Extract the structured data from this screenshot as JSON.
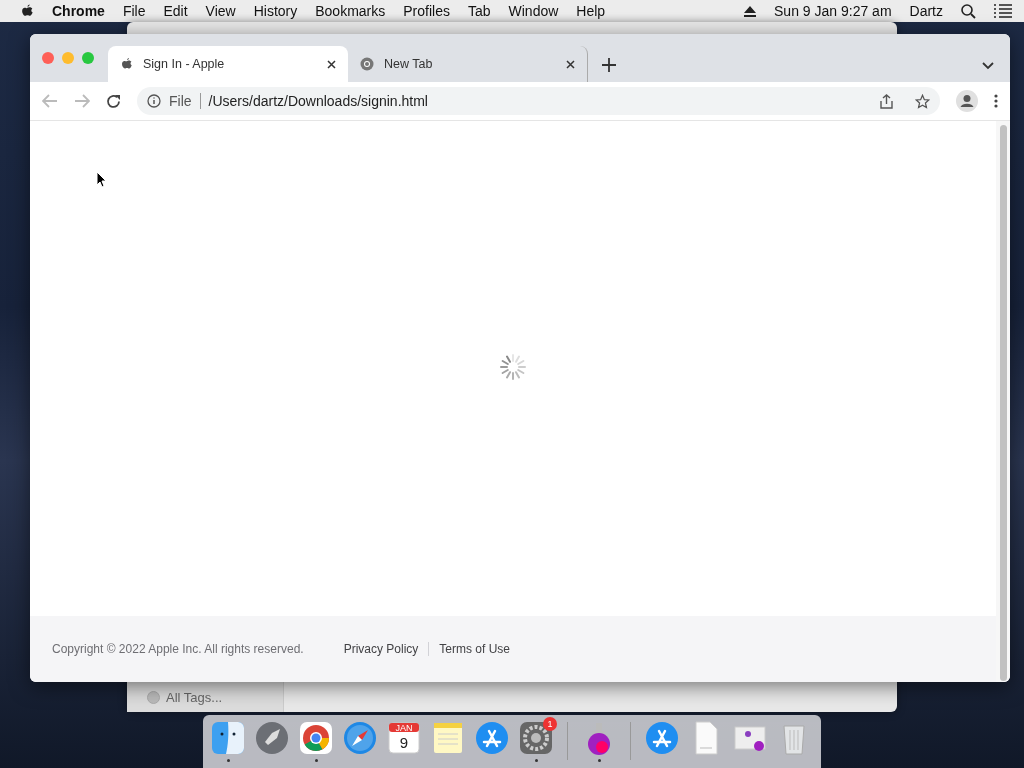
{
  "menubar": {
    "app": "Chrome",
    "menus": [
      "File",
      "Edit",
      "View",
      "History",
      "Bookmarks",
      "Profiles",
      "Tab",
      "Window",
      "Help"
    ],
    "clock": "Sun 9 Jan  9:27 am",
    "user": "Dartz"
  },
  "background_window": {
    "sidebar_item": "All Tags..."
  },
  "browser": {
    "tabs": [
      {
        "title": "Sign In - Apple",
        "selected": true,
        "kind": "apple"
      },
      {
        "title": "New Tab",
        "selected": false,
        "kind": "chrome"
      }
    ],
    "address": {
      "scheme": "File",
      "url": "/Users/dartz/Downloads/signin.html"
    },
    "page": {
      "loading": true,
      "copyright": "Copyright © 2022 Apple Inc. All rights reserved.",
      "links": [
        "Privacy Policy",
        "Terms of Use"
      ]
    }
  },
  "dock": [
    {
      "kind": "finder",
      "running": true
    },
    {
      "kind": "rocket",
      "running": false
    },
    {
      "kind": "chrome",
      "running": true
    },
    {
      "kind": "compass",
      "running": false
    },
    {
      "kind": "calendar",
      "running": false,
      "month": "JAN",
      "day": "9"
    },
    {
      "kind": "notes",
      "running": false
    },
    {
      "kind": "appstore",
      "running": false
    },
    {
      "kind": "gear",
      "running": true,
      "badge": "1"
    },
    {
      "kind": "separator"
    },
    {
      "kind": "sphere",
      "running": true
    },
    {
      "kind": "separator"
    },
    {
      "kind": "appstore",
      "running": false
    },
    {
      "kind": "document",
      "running": false
    },
    {
      "kind": "image",
      "running": false
    },
    {
      "kind": "trash",
      "running": false
    }
  ]
}
